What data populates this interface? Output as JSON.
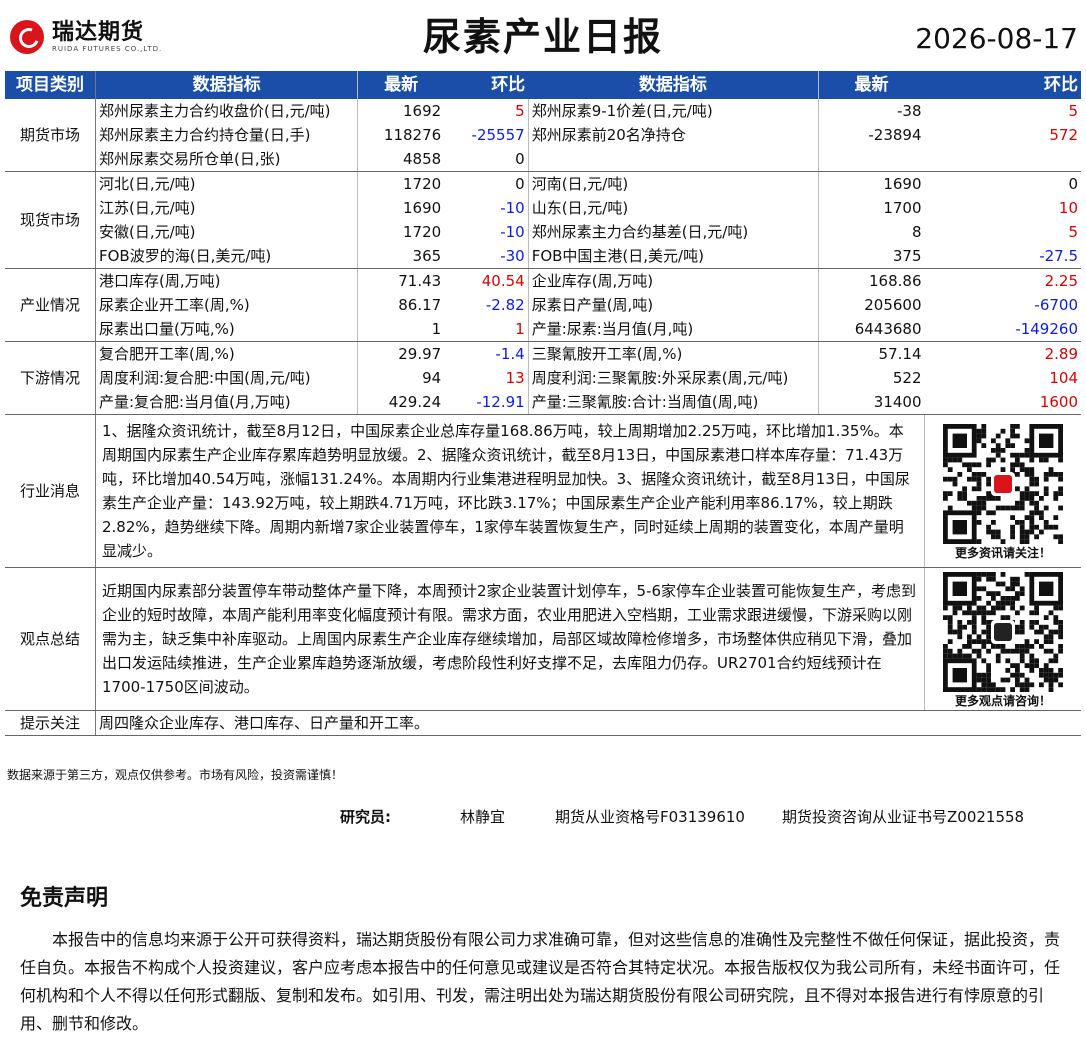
{
  "header": {
    "logo_cn": "瑞达期货",
    "logo_en": "RUIDA FUTURES CO.,LTD.",
    "title": "尿素产业日报",
    "date": "2026-08-17"
  },
  "table": {
    "headers": [
      "项目类别",
      "数据指标",
      "最新",
      "环比",
      "数据指标",
      "最新",
      "环比"
    ],
    "groups": [
      {
        "category": "期货市场",
        "rows": [
          {
            "l": {
              "name": "郑州尿素主力合约收盘价(日,元/吨)",
              "val": "1692",
              "chg": "5",
              "dir": "pos"
            },
            "r": {
              "name": "郑州尿素9-1价差(日,元/吨)",
              "val": "-38",
              "chg": "5",
              "dir": "pos"
            }
          },
          {
            "l": {
              "name": "郑州尿素主力合约持仓量(日,手)",
              "val": "118276",
              "chg": "-25557",
              "dir": "neg"
            },
            "r": {
              "name": "郑州尿素前20名净持仓",
              "val": "-23894",
              "chg": "572",
              "dir": "pos"
            }
          },
          {
            "l": {
              "name": "郑州尿素交易所仓单(日,张)",
              "val": "4858",
              "chg": "0",
              "dir": "zero"
            },
            "r": {
              "name": "",
              "val": "",
              "chg": "",
              "dir": "zero"
            }
          }
        ]
      },
      {
        "category": "现货市场",
        "rows": [
          {
            "l": {
              "name": "河北(日,元/吨)",
              "val": "1720",
              "chg": "0",
              "dir": "zero"
            },
            "r": {
              "name": "河南(日,元/吨)",
              "val": "1690",
              "chg": "0",
              "dir": "zero"
            }
          },
          {
            "l": {
              "name": "江苏(日,元/吨)",
              "val": "1690",
              "chg": "-10",
              "dir": "neg"
            },
            "r": {
              "name": "山东(日,元/吨)",
              "val": "1700",
              "chg": "10",
              "dir": "pos"
            }
          },
          {
            "l": {
              "name": "安徽(日,元/吨)",
              "val": "1720",
              "chg": "-10",
              "dir": "neg"
            },
            "r": {
              "name": "郑州尿素主力合约基差(日,元/吨)",
              "val": "8",
              "chg": "5",
              "dir": "pos"
            }
          },
          {
            "l": {
              "name": "FOB波罗的海(日,美元/吨)",
              "val": "365",
              "chg": "-30",
              "dir": "neg"
            },
            "r": {
              "name": "FOB中国主港(日,美元/吨)",
              "val": "375",
              "chg": "-27.5",
              "dir": "neg"
            }
          }
        ]
      },
      {
        "category": "产业情况",
        "rows": [
          {
            "l": {
              "name": "港口库存(周,万吨)",
              "val": "71.43",
              "chg": "40.54",
              "dir": "pos"
            },
            "r": {
              "name": "企业库存(周,万吨)",
              "val": "168.86",
              "chg": "2.25",
              "dir": "pos"
            }
          },
          {
            "l": {
              "name": "尿素企业开工率(周,%)",
              "val": "86.17",
              "chg": "-2.82",
              "dir": "neg"
            },
            "r": {
              "name": "尿素日产量(周,吨)",
              "val": "205600",
              "chg": "-6700",
              "dir": "neg"
            }
          },
          {
            "l": {
              "name": "尿素出口量(万吨,%)",
              "val": "1",
              "chg": "1",
              "dir": "pos"
            },
            "r": {
              "name": "产量:尿素:当月值(月,吨)",
              "val": "6443680",
              "chg": "-149260",
              "dir": "neg"
            }
          }
        ]
      },
      {
        "category": "下游情况",
        "rows": [
          {
            "l": {
              "name": "复合肥开工率(周,%)",
              "val": "29.97",
              "chg": "-1.4",
              "dir": "neg"
            },
            "r": {
              "name": "三聚氰胺开工率(周,%)",
              "val": "57.14",
              "chg": "2.89",
              "dir": "pos"
            }
          },
          {
            "l": {
              "name": "周度利润:复合肥:中国(周,元/吨)",
              "val": "94",
              "chg": "13",
              "dir": "pos"
            },
            "r": {
              "name": "周度利润:三聚氰胺:外采尿素(周,元/吨)",
              "val": "522",
              "chg": "104",
              "dir": "pos"
            }
          },
          {
            "l": {
              "name": "产量:复合肥:当月值(月,万吨)",
              "val": "429.24",
              "chg": "-12.91",
              "dir": "neg"
            },
            "r": {
              "name": "产量:三聚氰胺:合计:当周值(周,吨)",
              "val": "31400",
              "chg": "1600",
              "dir": "pos"
            }
          }
        ]
      }
    ]
  },
  "industry_news": {
    "label": "行业消息",
    "text": "1、据隆众资讯统计，截至8月12日，中国尿素企业总库存量168.86万吨，较上周期增加2.25万吨，环比增加1.35%。本周期国内尿素生产企业库存累库趋势明显放缓。2、据隆众资讯统计，截至8月13日，中国尿素港口样本库存量：71.43万吨，环比增加40.54万吨，涨幅131.24%。本周期内行业集港进程明显加快。3、据隆众资讯统计，截至8月13日，中国尿素生产企业产量：143.92万吨，较上期跌4.71万吨，环比跌3.17%；中国尿素生产企业产能利用率86.17%，较上期跌2.82%，趋势继续下降。周期内新增7家企业装置停车，1家停车装置恢复生产，同时延续上周期的装置变化，本周产量明显减少。",
    "qr_caption": "更多资讯请关注！"
  },
  "viewpoint": {
    "label": "观点总结",
    "text": "近期国内尿素部分装置停车带动整体产量下降，本周预计2家企业装置计划停车，5-6家停车企业装置可能恢复生产，考虑到企业的短时故障，本周产能利用率变化幅度预计有限。需求方面，农业用肥进入空档期，工业需求跟进缓慢，下游采购以刚需为主，缺乏集中补库驱动。上周国内尿素生产企业库存继续增加，局部区域故障检修增多，市场整体供应稍见下滑，叠加出口发运陆续推进，生产企业累库趋势逐渐放缓，考虑阶段性利好支撑不足，去库阻力仍存。UR2701合约短线预计在1700-1750区间波动。",
    "qr_caption": "更多观点请咨询！"
  },
  "tips": {
    "label": "提示关注",
    "text": "周四隆众企业库存、港口库存、日产量和开工率。"
  },
  "footer": {
    "note": "数据来源于第三方，观点仅供参考。市场有风险，投资需谨慎！",
    "researcher_label": "研究员:",
    "researcher_name": "林静宜",
    "license1": "期货从业资格号F03139610",
    "license2": "期货投资咨询从业证书号Z0021558"
  },
  "disclaimer": {
    "title": "免责声明",
    "text": "本报告中的信息均来源于公开可获得资料，瑞达期货股份有限公司力求准确可靠，但对这些信息的准确性及完整性不做任何保证，据此投资，责任自负。本报告不构成个人投资建议，客户应考虑本报告中的任何意见或建议是否符合其特定状况。本报告版权仅为我公司所有，未经书面许可，任何机构和个人不得以任何形式翻版、复制和发布。如引用、刊发，需注明出处为瑞达期货股份有限公司研究院，且不得对本报告进行有悖原意的引用、删节和修改。"
  },
  "colors": {
    "header_bg": "#1a4ea8",
    "positive": "#e00000",
    "negative": "#0a1ce8",
    "brand": "#d9151b"
  }
}
